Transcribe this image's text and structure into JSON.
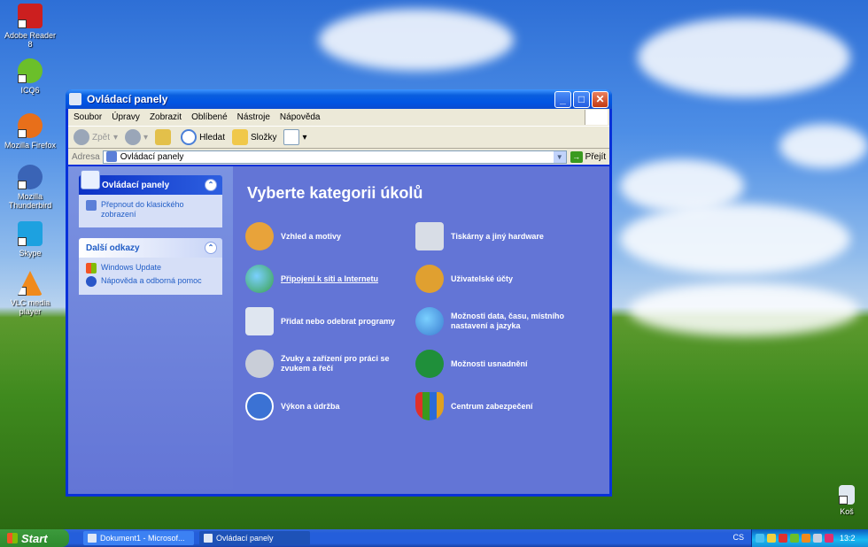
{
  "desktop": {
    "icons": [
      {
        "label": "Adobe Reader 8",
        "color": "#cc1f1f"
      },
      {
        "label": "ICQ6",
        "color": "#6bbf2a"
      },
      {
        "label": "Mozilla Firefox",
        "color": "#e86f1a"
      },
      {
        "label": "Mozilla Thunderbird",
        "color": "#3a64b6"
      },
      {
        "label": "Skype",
        "color": "#1da1e0"
      },
      {
        "label": "VLC media player",
        "color": "#f08a1c"
      }
    ],
    "recycle_bin": "Koš"
  },
  "window": {
    "title": "Ovládací panely",
    "menu": [
      "Soubor",
      "Úpravy",
      "Zobrazit",
      "Oblíbené",
      "Nástroje",
      "Nápověda"
    ],
    "toolbar": {
      "back": "Zpět",
      "search": "Hledat",
      "folders": "Složky"
    },
    "address": {
      "label": "Adresa",
      "value": "Ovládací panely",
      "go": "Přejít"
    },
    "sidebar": {
      "panel1": {
        "title": "Ovládací panely",
        "items": [
          "Přepnout do klasického zobrazení"
        ]
      },
      "panel2": {
        "title": "Další odkazy",
        "items": [
          "Windows Update",
          "Nápověda a odborná pomoc"
        ]
      }
    },
    "main": {
      "heading": "Vyberte kategorii úkolů",
      "categories": [
        {
          "label": "Vzhled a motivy",
          "color": "#e8a33a"
        },
        {
          "label": "Tiskárny a jiný hardware",
          "color": "#d8dde6"
        },
        {
          "label": "Připojení k síti a Internetu",
          "color": "#3aa04a"
        },
        {
          "label": "Uživatelské účty",
          "color": "#e0a030"
        },
        {
          "label": "Přidat nebo odebrat programy",
          "color": "#dfe6f0"
        },
        {
          "label": "Možnosti data, času, místního nastavení a jazyka",
          "color": "#3a7bd0"
        },
        {
          "label": "Zvuky a zařízení pro práci se zvukem a řečí",
          "color": "#c9ced8"
        },
        {
          "label": "Možnosti usnadnění",
          "color": "#1f8f3a"
        },
        {
          "label": "Výkon a údržba",
          "color": "#3b72d4"
        },
        {
          "label": "Centrum zabezpečení",
          "color": "#e0a020"
        }
      ]
    }
  },
  "taskbar": {
    "start": "Start",
    "tasks": [
      "Dokument1 - Microsof...",
      "Ovládací panely"
    ],
    "lang": "CS",
    "clock": "13:2"
  }
}
